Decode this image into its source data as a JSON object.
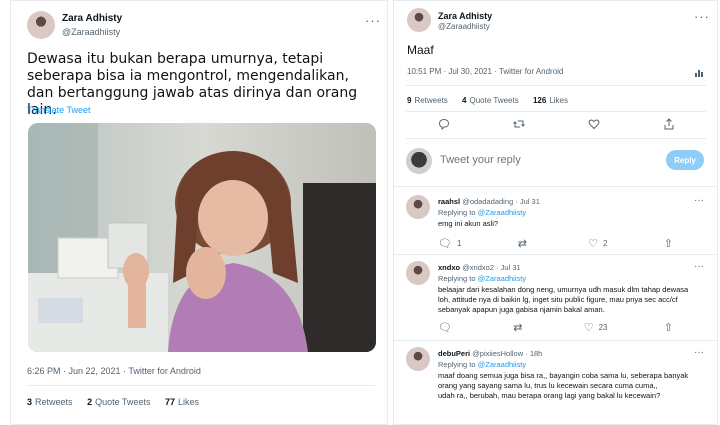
{
  "left_tweet": {
    "name": "Zara Adhisty",
    "handle": "@Zaraadhiisty",
    "text": "Dewasa itu bukan berapa umurnya, tetapi seberapa bisa ia mengontrol, mengendalikan, dan bertanggung jawab atas dirinya dan orang lain.",
    "translate": "Translate Tweet",
    "meta": "6:26 PM · Jun 22, 2021 · Twitter for Android",
    "retweets_count": "3",
    "retweets_label": "Retweets",
    "quotes_count": "2",
    "quotes_label": "Quote Tweets",
    "likes_count": "77",
    "likes_label": "Likes",
    "more": "···"
  },
  "right_tweet": {
    "name": "Zara Adhisty",
    "handle": "@Zaraadhiisty",
    "text": "Maaf",
    "meta": "10:51 PM · Jul 30, 2021 · Twitter for Android",
    "retweets_count": "9",
    "retweets_label": "Retweets",
    "quotes_count": "4",
    "quotes_label": "Quote Tweets",
    "likes_count": "126",
    "likes_label": "Likes",
    "more": "···"
  },
  "reply_box": {
    "placeholder": "Tweet your reply",
    "button": "Reply"
  },
  "replies": [
    {
      "name": "raahsl",
      "meta": "@odadadading · Jul 31",
      "replying_to": "Replying to",
      "reply_handle": "@Zaraadhiisty",
      "lines": [
        "emg ini akun asli?"
      ],
      "replies": "1",
      "retweets": "",
      "likes": "2"
    },
    {
      "name": "xndxo",
      "meta": "@xndxo2 · Jul 31",
      "replying_to": "Replying to",
      "reply_handle": "@Zaraadhiisty",
      "lines": [
        "belaajar dari kesalahan dong neng, umurnya udh masuk dlm tahap dewasa",
        "loh, attitude nya di baikin lg, inget situ public figure, mau pnya sec acc/cf",
        "sebanyak apapun juga gabisa njamin bakal aman."
      ],
      "replies": "",
      "retweets": "",
      "likes": "23"
    },
    {
      "name": "debuPeri",
      "meta": "@pixiiesHollow · 18h",
      "replying_to": "Replying to",
      "reply_handle": "@Zaraadhiisty",
      "lines": [
        "maaf doang semua juga bisa ra,, bayangin coba sama lu, seberapa banyak",
        "orang yang sayang sama lu, trus lu kecewain secara cuma cuma,,",
        "udah ra,, berubah, mau berapa orang lagi yang bakal lu kecewain?"
      ],
      "replies": "",
      "retweets": "",
      "likes": ""
    }
  ],
  "icons": {
    "reply": "reply-icon",
    "retweet": "retweet-icon",
    "like": "heart-icon",
    "share": "share-icon",
    "analytics": "analytics-icon"
  },
  "colors": {
    "accent": "#1d9bf0",
    "reply_button": "#8ecdf7",
    "muted": "#536471"
  }
}
